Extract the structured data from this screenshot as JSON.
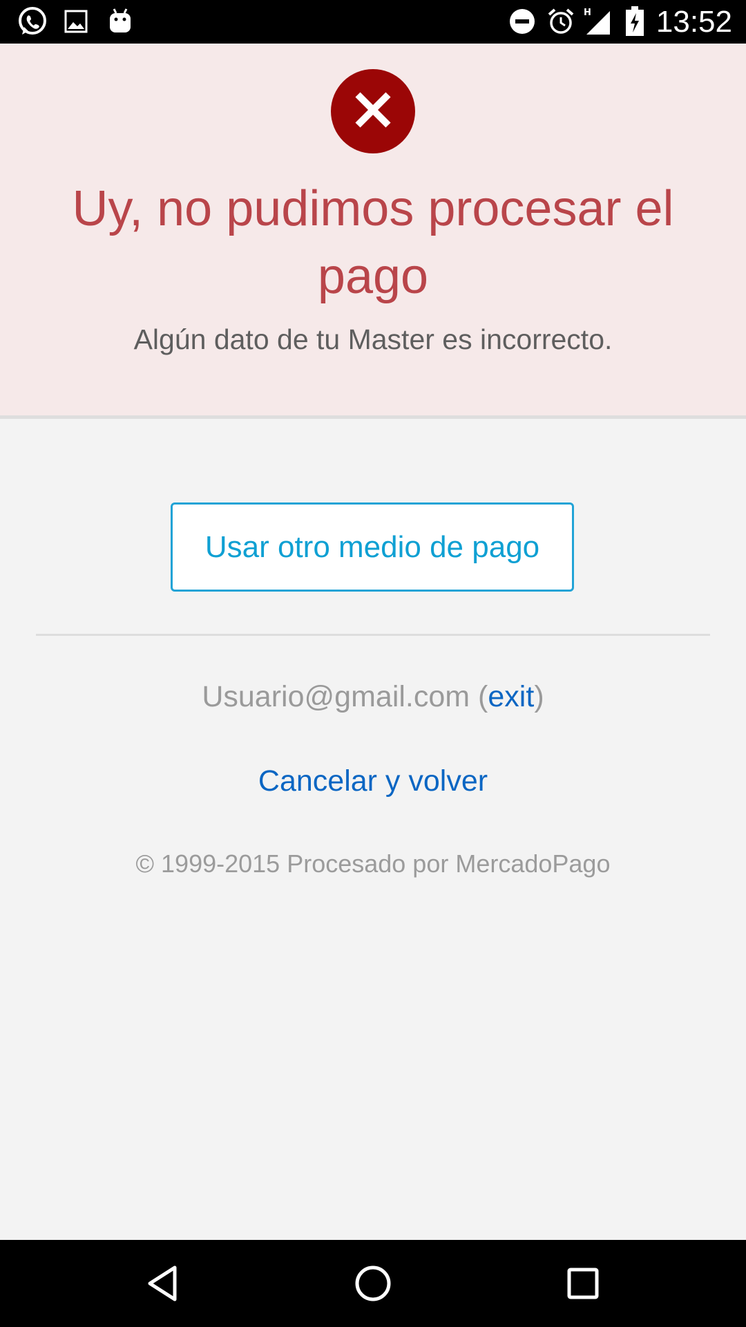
{
  "status_bar": {
    "time": "13:52",
    "left_icons": [
      "whatsapp-icon",
      "image-icon",
      "android-icon"
    ],
    "right_icons": [
      "do-not-disturb-icon",
      "alarm-icon",
      "signal-h-icon",
      "battery-charging-icon"
    ]
  },
  "error": {
    "icon": "close-icon",
    "color": "#9b0606",
    "title": "Uy, no pudimos procesar el pago",
    "subtitle": "Algún dato de tu Master es incorrecto."
  },
  "actions": {
    "alt_payment_label": "Usar otro medio de pago"
  },
  "account": {
    "email": "Usuario@gmail.com",
    "open_paren": " (",
    "exit_label": "exit",
    "close_paren": ")"
  },
  "cancel": {
    "label": "Cancelar y volver"
  },
  "footer": {
    "copyright": "© 1999-2015 Procesado por MercadoPago"
  },
  "nav_bar": {
    "buttons": [
      "back-icon",
      "home-icon",
      "recents-icon"
    ]
  }
}
